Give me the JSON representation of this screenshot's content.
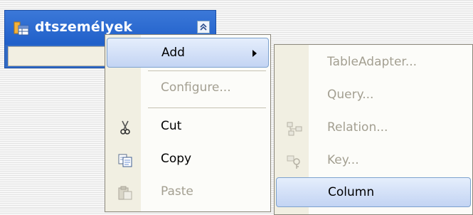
{
  "table": {
    "title": "dtszemélyek"
  },
  "context_menu": {
    "items": [
      {
        "label": "Add",
        "enabled": true,
        "highlighted": true,
        "submenu": true
      },
      {
        "label": "Configure...",
        "enabled": false
      },
      {
        "label": "Cut",
        "enabled": true,
        "icon": "scissors-icon"
      },
      {
        "label": "Copy",
        "enabled": true,
        "icon": "copy-icon"
      },
      {
        "label": "Paste",
        "enabled": false,
        "icon": "paste-icon"
      }
    ]
  },
  "add_submenu": {
    "items": [
      {
        "label": "TableAdapter...",
        "enabled": false
      },
      {
        "label": "Query...",
        "enabled": false
      },
      {
        "label": "Relation...",
        "enabled": false,
        "icon": "relation-icon"
      },
      {
        "label": "Key...",
        "enabled": false,
        "icon": "key-icon"
      },
      {
        "label": "Column",
        "enabled": true,
        "highlighted": true
      }
    ]
  },
  "colors": {
    "header_blue": "#316ac5",
    "menu_highlight": "#c3d4f3",
    "disabled_text": "#a39f91"
  }
}
